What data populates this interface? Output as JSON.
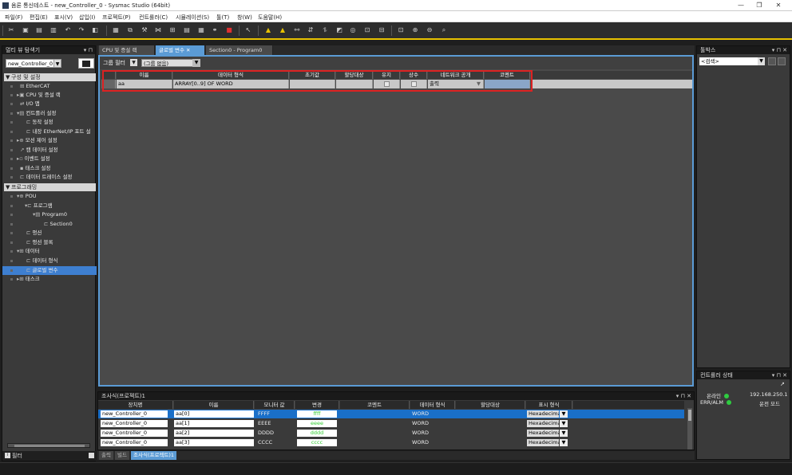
{
  "window": {
    "title": "옴론 통신테스트 - new_Controller_0 - Sysmac Studio (64bit)",
    "minimize": "—",
    "restore": "❐",
    "close": "✕"
  },
  "menu": [
    "파일(F)",
    "편집(E)",
    "표시(V)",
    "삽입(I)",
    "프로젝트(P)",
    "컨트롤러(C)",
    "시뮬레이션(S)",
    "툴(T)",
    "창(W)",
    "도움말(H)"
  ],
  "multiview": {
    "title": "멀티 뷰 탐색기",
    "pin": "▾ ⊓",
    "controller": "new_Controller_0",
    "dropdown": "▼",
    "config_section": "구성 및 설정",
    "config_items": [
      "EtherCAT",
      "CPU 및 증설 랙",
      "I/O 맵",
      "컨트롤러 설정",
      "동작 설정",
      "내장 EtherNet/IP 포트 설",
      "모션 제어 설정",
      "캠 데이터 설정",
      "이벤트 설정",
      "태스크 설정",
      "데이터 트레이스 설정"
    ],
    "prog_section": "프로그래밍",
    "prog_items": [
      "POU",
      "프로그램",
      "Program0",
      "Section0",
      "펑션",
      "펑션 블록",
      "데이터",
      "데이터 형식",
      "글로벌 변수",
      "태스크"
    ],
    "filter_label": "필터",
    "section_arrow": "▼"
  },
  "doc_tabs": [
    "CPU 및 증설 랙",
    "글로벌 변수",
    "Section0 - Program0"
  ],
  "doc_tab_close": "✕",
  "editor": {
    "group_filter_label": "그룹 필터",
    "group_filter_icon": "▼",
    "group_filter_value": "(그룹 없음)",
    "group_dropdown": "▼",
    "columns": [
      "이름",
      "데이터 형식",
      "초기값",
      "할당대상",
      "유지",
      "상수",
      "네트워크 공개",
      "코멘트"
    ],
    "rows": [
      {
        "name": "aa",
        "data_type": "ARRAY[0..9] OF WORD",
        "initial": "",
        "assign": "",
        "retain": false,
        "constant": false,
        "network": "출력",
        "comment": ""
      }
    ],
    "network_dropdown": "▼"
  },
  "toolbox": {
    "title": "툴박스",
    "pin": "▾ ⊓ ✕",
    "search": "<검색>",
    "dropdown": "▼"
  },
  "controller_status": {
    "title": "컨트롤러 상태",
    "pin": "▾ ⊓ ✕",
    "online_label": "온라인",
    "ip": "192.168.250.1",
    "err_label": "ERR/ALM",
    "mode": "운전 모드",
    "expand": "↗"
  },
  "watch": {
    "title": "조사식(프로젝트)1",
    "pin": "▾ ⊓ ✕",
    "columns": [
      "장치명",
      "이름",
      "모니터 값",
      "변경",
      "코멘트",
      "데이터 형식",
      "할당대상",
      "표시 형식"
    ],
    "rows": [
      {
        "device": "new_Controller_0",
        "name": "aa[0]",
        "monitor": "FFFF",
        "modify": "ffff",
        "comment": "",
        "type": "WORD",
        "assign": "",
        "format": "Hexadecima"
      },
      {
        "device": "new_Controller_0",
        "name": "aa[1]",
        "monitor": "EEEE",
        "modify": "eeee",
        "comment": "",
        "type": "WORD",
        "assign": "",
        "format": "Hexadecima"
      },
      {
        "device": "new_Controller_0",
        "name": "aa[2]",
        "monitor": "DDDD",
        "modify": "dddd",
        "comment": "",
        "type": "WORD",
        "assign": "",
        "format": "Hexadecima"
      },
      {
        "device": "new_Controller_0",
        "name": "aa[3]",
        "monitor": "CCCC",
        "modify": "cccc",
        "comment": "",
        "type": "WORD",
        "assign": "",
        "format": "Hexadecima"
      }
    ],
    "format_dropdown": "▼"
  },
  "bottom_tabs": [
    "출력",
    "빌드",
    "조사식(프로젝트)1"
  ],
  "colors": {
    "accent": "#5b9bd5",
    "highlight": "#dd2222",
    "toolbar_stripe": "#e8c200",
    "online": "#2ecc40"
  }
}
